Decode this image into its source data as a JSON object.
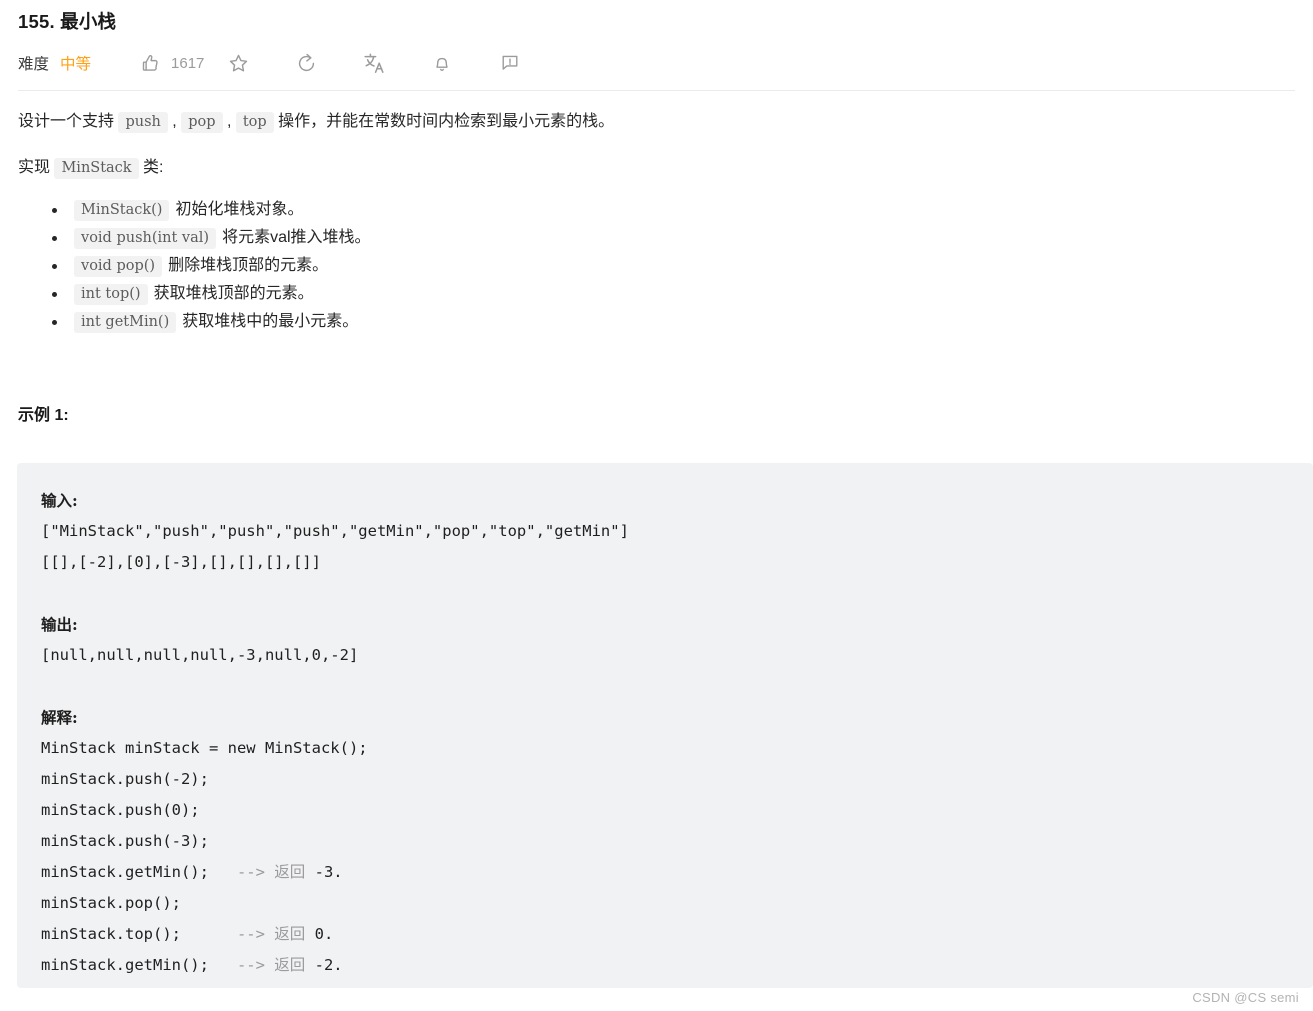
{
  "problem": {
    "title": "155. 最小栈",
    "difficulty_label": "难度",
    "difficulty_value": "中等",
    "accent_color": "#ffa116"
  },
  "actions": {
    "like": {
      "icon": "thumbs-up-icon",
      "count": "1617"
    },
    "favorite": {
      "icon": "star-icon"
    },
    "share": {
      "icon": "refresh-share-icon"
    },
    "translate": {
      "icon": "translate-icon"
    },
    "notify": {
      "icon": "bell-icon"
    },
    "comment": {
      "icon": "comment-icon"
    }
  },
  "description": {
    "line1_pre": "设计一个支持 ",
    "code_push": "push",
    "sep1": " , ",
    "code_pop": "pop",
    "sep2": " , ",
    "code_top": "top",
    "line1_post": " 操作，并能在常数时间内检索到最小元素的栈。",
    "line2_pre": "实现 ",
    "code_minstack": "MinStack",
    "line2_post": " 类:"
  },
  "methods": [
    {
      "code": "MinStack()",
      "desc": "初始化堆栈对象。"
    },
    {
      "code": "void push(int val)",
      "desc": "将元素val推入堆栈。"
    },
    {
      "code": "void pop()",
      "desc": "删除堆栈顶部的元素。"
    },
    {
      "code": "int top()",
      "desc": "获取堆栈顶部的元素。"
    },
    {
      "code": "int getMin()",
      "desc": "获取堆栈中的最小元素。"
    }
  ],
  "example": {
    "heading": "示例 1:",
    "input_label": "输入:",
    "input_lines": [
      "[\"MinStack\",\"push\",\"push\",\"push\",\"getMin\",\"pop\",\"top\",\"getMin\"]",
      "[[],[-2],[0],[-3],[],[],[],[]]"
    ],
    "output_label": "输出:",
    "output_lines": [
      "[null,null,null,null,-3,null,0,-2]"
    ],
    "explanation_label": "解释:",
    "explanation_lines": [
      {
        "code": "MinStack minStack = new MinStack();",
        "comment": "",
        "value": ""
      },
      {
        "code": "minStack.push(-2);",
        "comment": "",
        "value": ""
      },
      {
        "code": "minStack.push(0);",
        "comment": "",
        "value": ""
      },
      {
        "code": "minStack.push(-3);",
        "comment": "",
        "value": ""
      },
      {
        "code": "minStack.getMin();",
        "comment": "   --> 返回 ",
        "value": "-3."
      },
      {
        "code": "minStack.pop();",
        "comment": "",
        "value": ""
      },
      {
        "code": "minStack.top();",
        "comment": "      --> 返回 ",
        "value": "0."
      },
      {
        "code": "minStack.getMin();",
        "comment": "   --> 返回 ",
        "value": "-2."
      }
    ]
  },
  "watermark": "CSDN @CS semi"
}
